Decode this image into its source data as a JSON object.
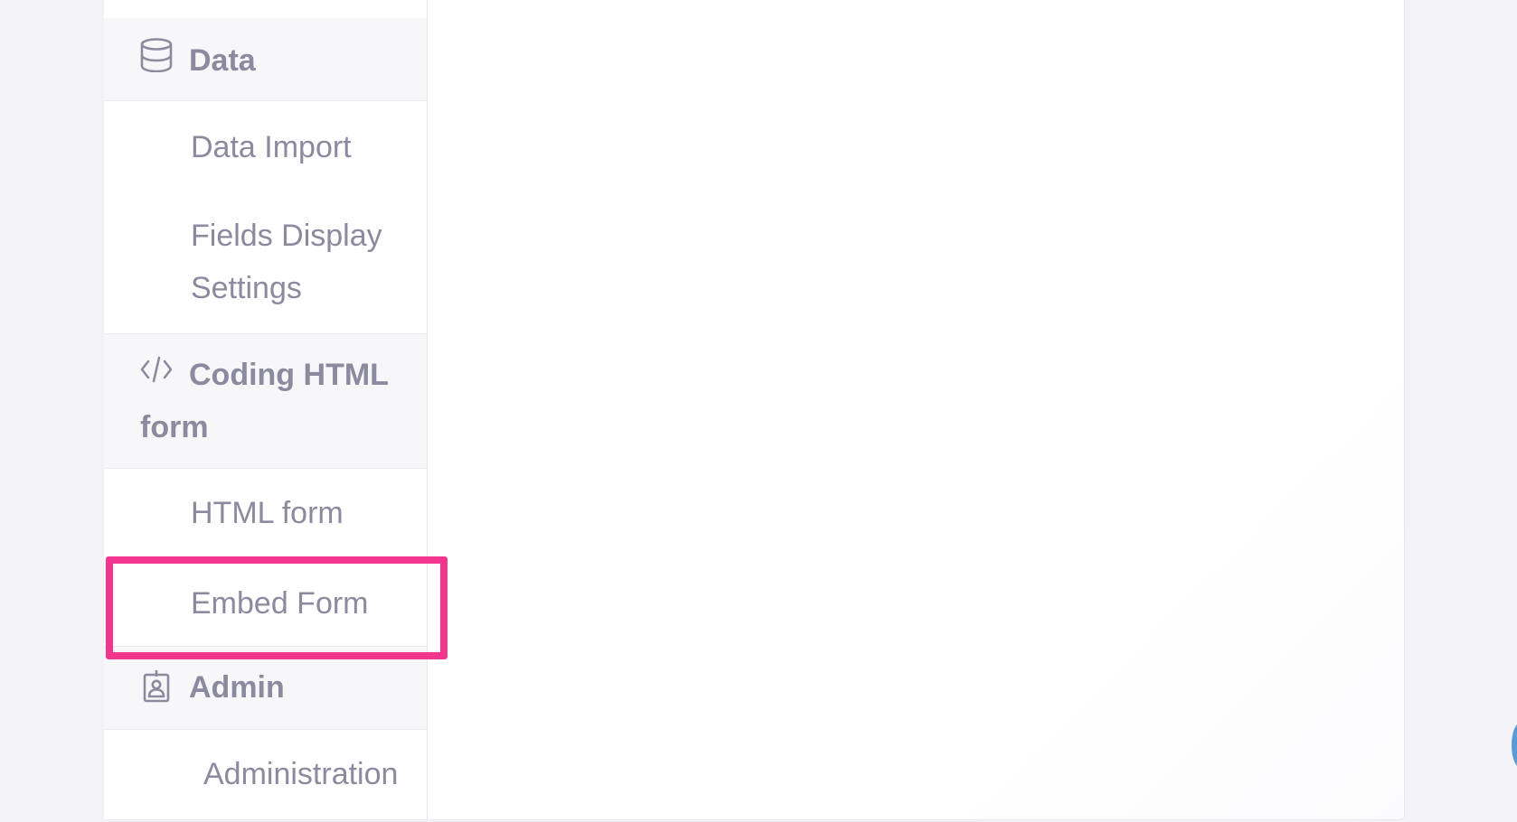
{
  "sidebar": {
    "sections": [
      {
        "icon": "database-icon",
        "label": "Data",
        "items": [
          "Data Import",
          "Fields Display Settings"
        ]
      },
      {
        "icon": "code-icon",
        "label": "Coding HTML form",
        "items": [
          "HTML form",
          "Embed Form"
        ]
      },
      {
        "icon": "badge-icon",
        "label": "Admin",
        "items": [
          "Administration"
        ]
      }
    ]
  },
  "colors": {
    "background": "#f3f2f7",
    "section_bg": "#f7f7f9",
    "text": "#8b8a9e",
    "highlight": "#f2368e"
  },
  "highlighted_item": "Embed Form"
}
